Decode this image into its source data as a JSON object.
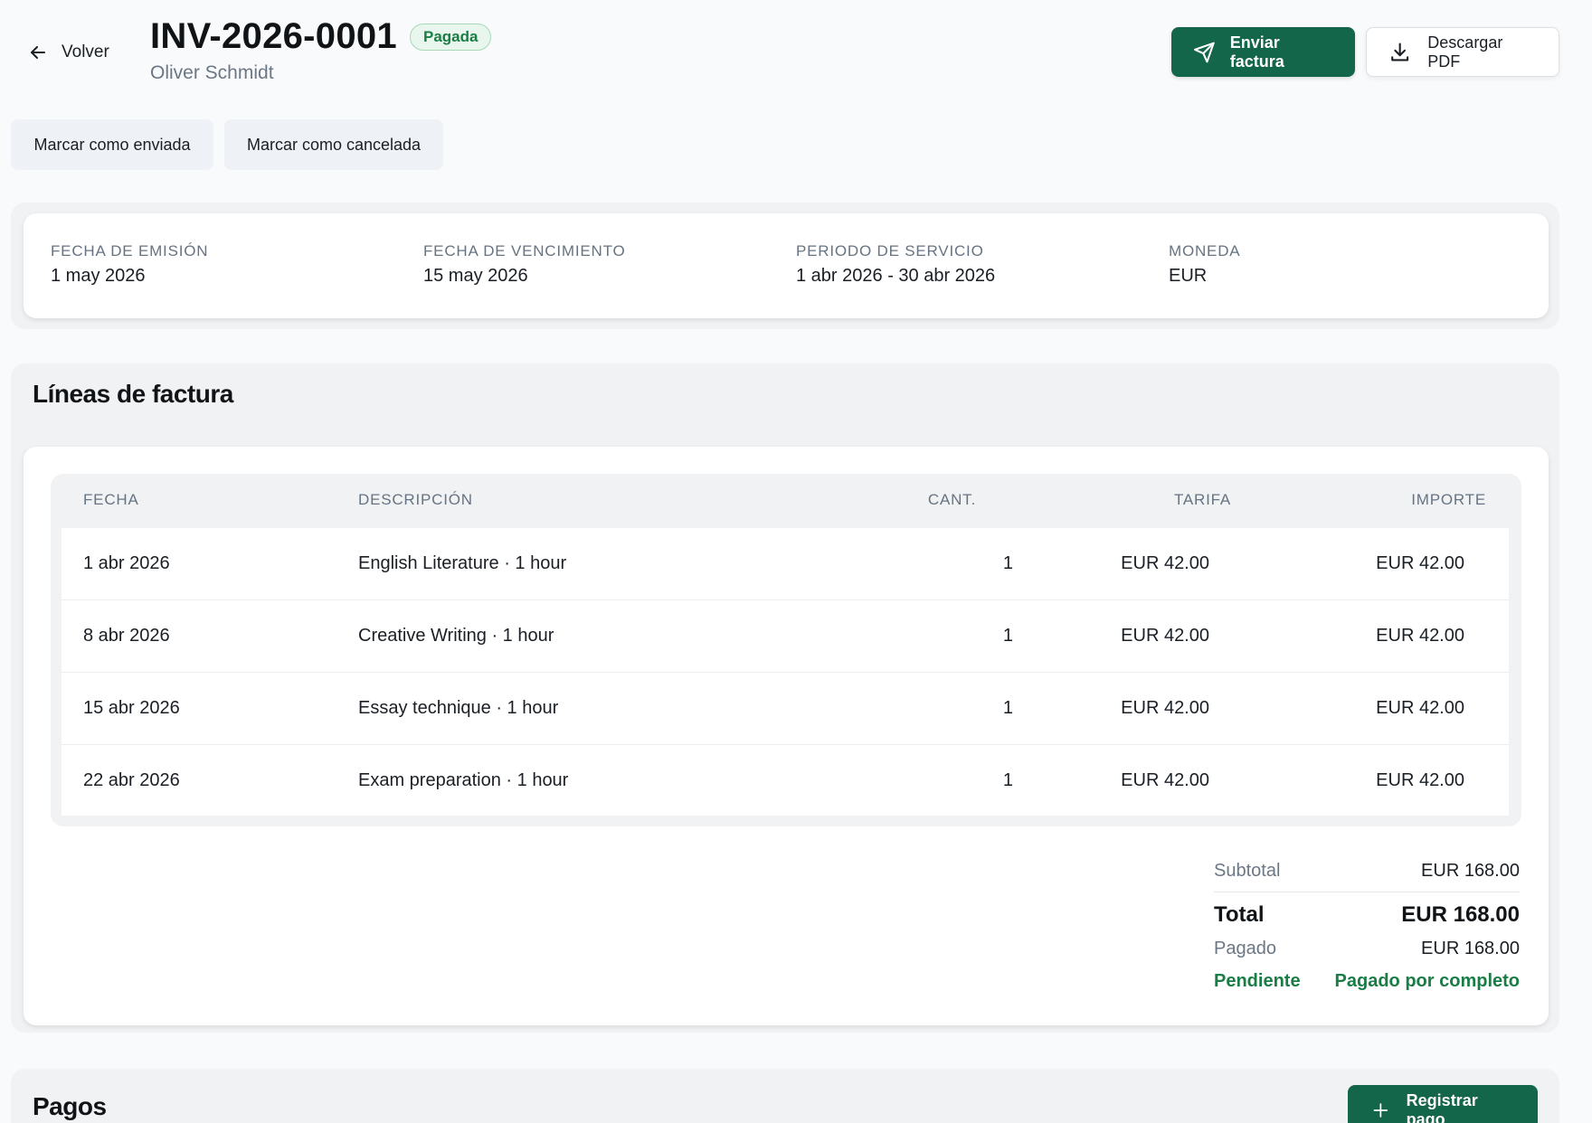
{
  "header": {
    "back_label": "Volver",
    "invoice_number": "INV-2026-0001",
    "status": "Pagada",
    "client": "Oliver Schmidt",
    "send_label": "Enviar factura",
    "download_label": "Descargar PDF"
  },
  "actions": {
    "mark_sent": "Marcar como enviada",
    "mark_cancelled": "Marcar como cancelada"
  },
  "meta": {
    "issue_label": "FECHA DE EMISIÓN",
    "issue_value": "1 may 2026",
    "due_label": "FECHA DE VENCIMIENTO",
    "due_value": "15 may 2026",
    "period_label": "PERIODO DE SERVICIO",
    "period_value": "1 abr 2026 - 30 abr 2026",
    "currency_label": "MONEDA",
    "currency_value": "EUR"
  },
  "lines": {
    "title": "Líneas de factura",
    "columns": [
      "FECHA",
      "DESCRIPCIÓN",
      "CANT.",
      "TARIFA",
      "IMPORTE"
    ],
    "rows": [
      {
        "date": "1 abr 2026",
        "description": "English Literature · 1 hour",
        "qty": "1",
        "rate": "EUR 42.00",
        "amount": "EUR 42.00"
      },
      {
        "date": "8 abr 2026",
        "description": "Creative Writing · 1 hour",
        "qty": "1",
        "rate": "EUR 42.00",
        "amount": "EUR 42.00"
      },
      {
        "date": "15 abr 2026",
        "description": "Essay technique · 1 hour",
        "qty": "1",
        "rate": "EUR 42.00",
        "amount": "EUR 42.00"
      },
      {
        "date": "22 abr 2026",
        "description": "Exam preparation · 1 hour",
        "qty": "1",
        "rate": "EUR 42.00",
        "amount": "EUR 42.00"
      }
    ]
  },
  "totals": {
    "subtotal_label": "Subtotal",
    "subtotal_value": "EUR 168.00",
    "total_label": "Total",
    "total_value": "EUR 168.00",
    "paid_label": "Pagado",
    "paid_value": "EUR 168.00",
    "pending_label": "Pendiente",
    "pending_value": "Pagado por completo"
  },
  "payments": {
    "title": "Pagos",
    "register_label": "Registrar pago"
  },
  "colors": {
    "primary": "#13664a",
    "success": "#1a7d46"
  }
}
